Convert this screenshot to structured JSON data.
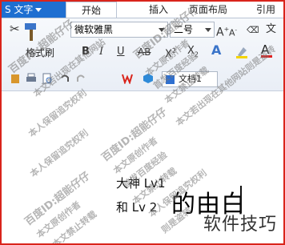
{
  "tabbar": {
    "app_label": "S 文字",
    "tabs": [
      "开始",
      "插入",
      "页面布局",
      "引用"
    ]
  },
  "ribbon": {
    "format_painter": "格式刷",
    "font_name": "微软雅黑",
    "font_size": "二号",
    "wen_button": "文",
    "doc_tab": "文档1"
  },
  "document": {
    "line1": "大神 Lv1",
    "line2": "和  Lv 2",
    "big_text": "的由白",
    "brand": "软件技巧"
  },
  "watermark": {
    "t1": "百度ID:超能仔仔",
    "t2": "本文若出现在其他网站",
    "t3": "本人保留追究权利",
    "t4": "首发百度经验",
    "t5": "本文禁止转载",
    "t6": "本文原创作者",
    "t7": "则是盗转",
    "t8": "本文若出现在其他网站则是盗转"
  },
  "colors": {
    "accent": "#1f6fd1",
    "frame": "#d9241b",
    "font_color_bar": "#e02020",
    "highlight": "#f4d400"
  }
}
